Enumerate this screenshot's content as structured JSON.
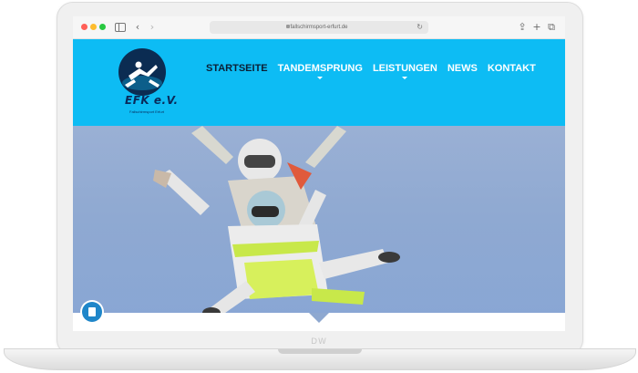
{
  "browser": {
    "url": "fallschirmsport-erfurt.de"
  },
  "site": {
    "logo_text": "EFK e.V.",
    "logo_subtitle": "Fallschirmsport Erfurt",
    "nav": [
      {
        "label": "STARTSEITE",
        "active": true,
        "has_submenu": false
      },
      {
        "label": "TANDEMSPRUNG",
        "active": false,
        "has_submenu": true
      },
      {
        "label": "LEISTUNGEN",
        "active": false,
        "has_submenu": true
      },
      {
        "label": "NEWS",
        "active": false,
        "has_submenu": false
      },
      {
        "label": "KONTAKT",
        "active": false,
        "has_submenu": false
      }
    ]
  },
  "colors": {
    "header_bg": "#0dbcf4",
    "active_nav": "#0b1f35",
    "nav_text": "#ffffff",
    "sky": "#8fa9d2"
  },
  "device": {
    "brand": "DW"
  }
}
